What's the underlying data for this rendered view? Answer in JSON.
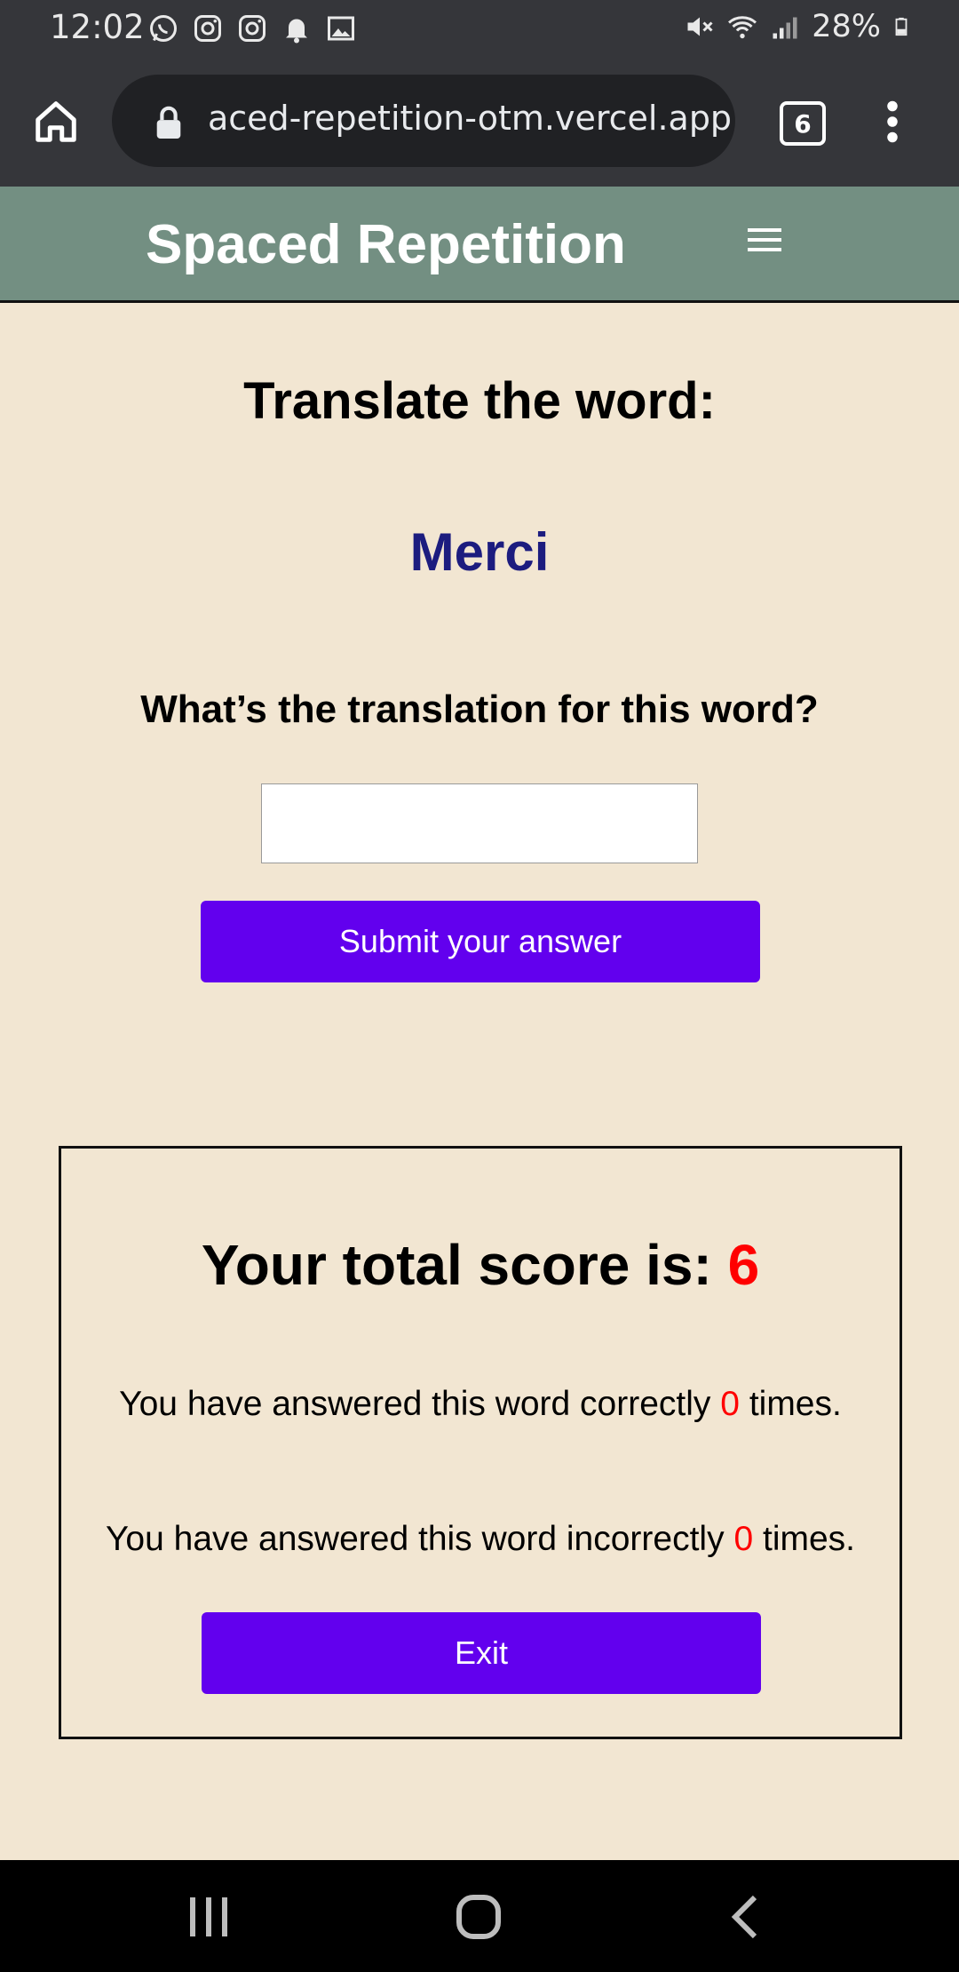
{
  "status_bar": {
    "time": "12:02",
    "battery": "28%",
    "left_icons": [
      "whatsapp-icon",
      "instagram-icon",
      "instagram-icon",
      "notification-bell-icon",
      "image-icon"
    ],
    "right_icons": [
      "mute-icon",
      "wifi-icon",
      "signal-icon",
      "battery-icon"
    ]
  },
  "browser": {
    "url": "aced-repetition-otm.vercel.app",
    "tab_count": "6"
  },
  "app": {
    "title": "Spaced Repetition"
  },
  "quiz": {
    "heading": "Translate the word:",
    "word": "Merci",
    "question": "What’s the translation for this word?",
    "answer_value": "",
    "submit_label": "Submit your answer"
  },
  "score": {
    "total_label": "Your total score is:",
    "total_value": "6",
    "correct_prefix": "You have answered this word correctly",
    "correct_count": "0",
    "correct_suffix": "times.",
    "incorrect_prefix": "You have answered this word incorrectly",
    "incorrect_count": "0",
    "incorrect_suffix": "times.",
    "exit_label": "Exit"
  },
  "colors": {
    "header_bg": "#738f82",
    "page_bg": "#f2e6d2",
    "accent_button": "#6200ee",
    "word_color": "#1c1c7f",
    "count_color": "#ff0000"
  }
}
